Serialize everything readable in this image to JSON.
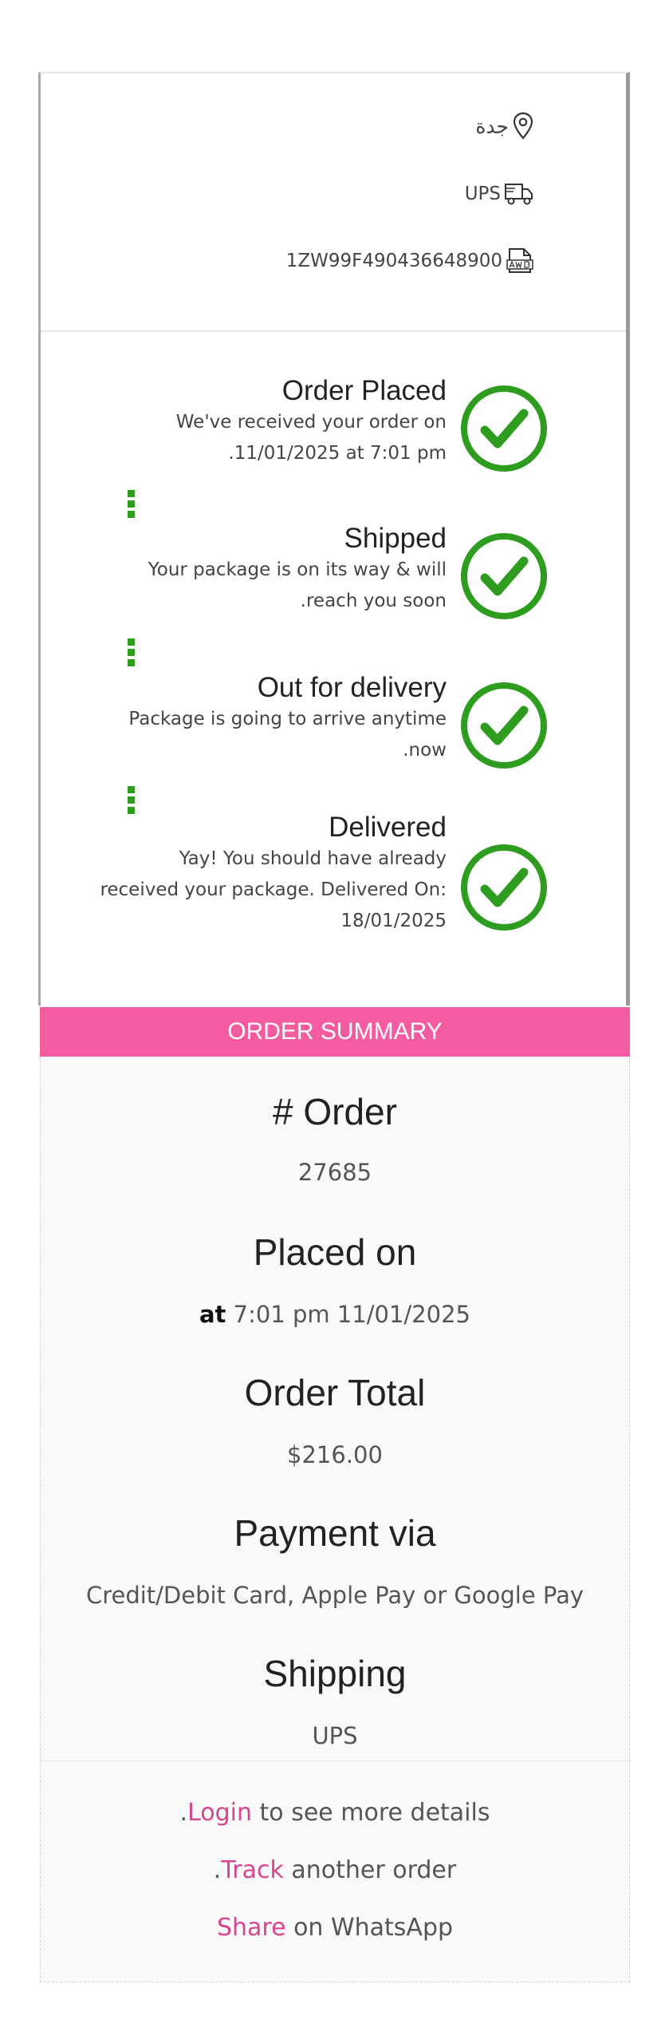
{
  "tracking": {
    "city": "جدة",
    "carrier": "UPS",
    "tracking_number": "1ZW99F490436648900"
  },
  "icons": [
    "map-pin-icon",
    "truck-icon",
    "document-awb-icon",
    "check-circle-icon"
  ],
  "colors": {
    "accent": "#f45ba0",
    "success": "#2e9c1e",
    "link": "#d6468f"
  },
  "steps": [
    {
      "title": "Order Placed",
      "desc": "We've received your order on 11/01/2025 at 7:01 pm."
    },
    {
      "title": "Shipped",
      "desc": "Your package is on its way & will reach you soon."
    },
    {
      "title": "Out for delivery",
      "desc": "Package is going to arrive anytime now."
    },
    {
      "title": "Delivered",
      "desc": "Yay! You should have already received your package. Delivered On: 18/01/2025"
    }
  ],
  "summary": {
    "header": "ORDER SUMMARY",
    "order_label": "# Order",
    "order_number": "27685",
    "placed_label": "Placed on",
    "placed_at": "at",
    "placed_value": "7:01 pm 11/01/2025",
    "total_label": "Order Total",
    "total_value": "$216.00",
    "payment_label": "Payment via",
    "payment_value": "Credit/Debit Card, Apple Pay or Google Pay",
    "shipping_label": "Shipping",
    "shipping_value": "UPS"
  },
  "actions": {
    "login_link": "Login",
    "login_text": "to see more details",
    "track_link": "Track",
    "track_text": "another order",
    "share_link": "Share",
    "share_text": "on WhatsApp"
  }
}
